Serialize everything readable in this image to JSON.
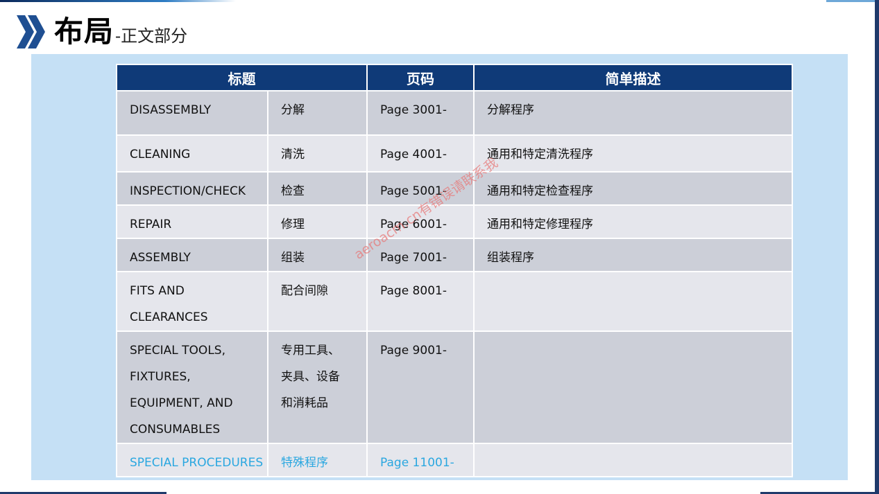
{
  "slide": {
    "title_main": "布局",
    "title_sub": "-正文部分",
    "watermark": "aeroacm.cn有错误请联系我"
  },
  "table": {
    "headers": [
      "标题",
      "页码",
      "简单描述"
    ],
    "rows": [
      {
        "en": "DISASSEMBLY",
        "zh": "分解",
        "page": "Page 3001-",
        "desc": "分解程序"
      },
      {
        "en": "CLEANING",
        "zh": "清洗",
        "page": "Page 4001-",
        "desc": "通用和特定清洗程序"
      },
      {
        "en": "INSPECTION/CHECK",
        "zh": "检查",
        "page": "Page 5001-",
        "desc": "通用和特定检查程序"
      },
      {
        "en": "REPAIR",
        "zh": "修理",
        "page": "Page 6001-",
        "desc": "通用和特定修理程序"
      },
      {
        "en": "ASSEMBLY",
        "zh": "组装",
        "page": "Page 7001-",
        "desc": "组装程序"
      },
      {
        "en": "FITS AND\nCLEARANCES",
        "zh": "配合间隙",
        "page": "Page 8001-",
        "desc": ""
      },
      {
        "en": "SPECIAL TOOLS,\nFIXTURES,\nEQUIPMENT, AND\nCONSUMABLES",
        "zh": "专用工具、\n夹具、设备\n和消耗品",
        "page": "Page 9001-",
        "desc": ""
      },
      {
        "en": "SPECIAL PROCEDURES",
        "zh": "特殊程序",
        "page": "Page 11001-",
        "desc": ""
      }
    ]
  },
  "colors": {
    "header_bg": "#0f3a78",
    "row_dark": "#cccfd8",
    "row_light": "#e5e6ec",
    "content_bg": "#c5e0f5",
    "link_text": "#2aa7e0"
  }
}
